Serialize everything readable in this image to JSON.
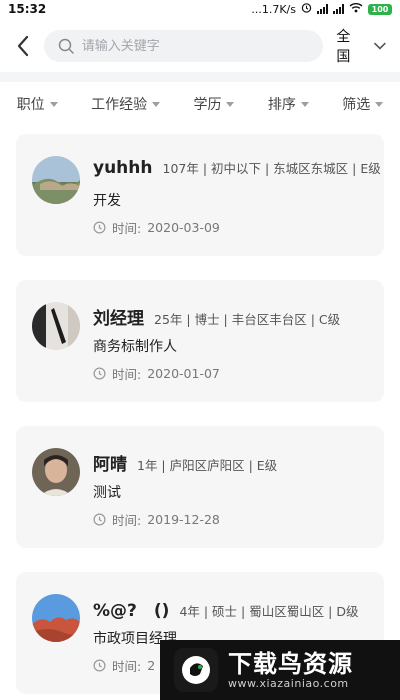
{
  "status_bar": {
    "time": "15:32",
    "speed": "...1.7K/s",
    "battery": "100"
  },
  "header": {
    "search_placeholder": "请输入关键字",
    "region": "全国"
  },
  "filters": [
    "职位",
    "工作经验",
    "学历",
    "排序",
    "筛选"
  ],
  "cards": [
    {
      "name": "yuhhh",
      "meta": "107年 | 初中以下 | 东城区东城区 | E级",
      "title": "开发",
      "time_label": "时间:",
      "date": "2020-03-09"
    },
    {
      "name": "刘经理",
      "meta": "25年 | 博士 | 丰台区丰台区 | C级",
      "title": "商务标制作人",
      "time_label": "时间:",
      "date": "2020-01-07"
    },
    {
      "name": "阿晴",
      "meta": "1年 | 庐阳区庐阳区 | E级",
      "title": "测试",
      "time_label": "时间:",
      "date": "2019-12-28"
    },
    {
      "name": "%@?　()",
      "meta": "4年 | 硕士 | 蜀山区蜀山区 | D级",
      "title": "市政项目经理",
      "time_label": "时间:",
      "date": "2"
    }
  ],
  "watermark": {
    "title": "下载鸟资源",
    "url": "www.xiazainiao.com"
  },
  "colors": {
    "card_bg": "#f6f6f7",
    "battery": "#2db34a"
  }
}
